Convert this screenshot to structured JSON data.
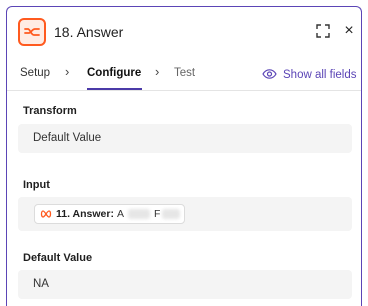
{
  "header": {
    "title": "18. Answer",
    "app_icon": "formatter-icon",
    "accent_color": "#ff5a1f",
    "expand_icon": "expand-icon",
    "close_icon": "close-icon",
    "close_glyph": "×"
  },
  "tabs": {
    "setup_label": "Setup",
    "configure_label": "Configure",
    "test_label": "Test",
    "separator": "›",
    "active": "Configure",
    "show_all_label": "Show all fields",
    "show_all_icon": "eye-icon",
    "accent_color": "#5b45b6"
  },
  "fields": {
    "transform": {
      "label": "Transform",
      "value": "Default Value"
    },
    "input": {
      "label": "Input",
      "chip_step": "11. Answer:",
      "chip_value_start": "A",
      "chip_value_mid": "F",
      "chip_icon": "loop-icon"
    },
    "default_value": {
      "label": "Default Value",
      "value": "NA"
    }
  }
}
